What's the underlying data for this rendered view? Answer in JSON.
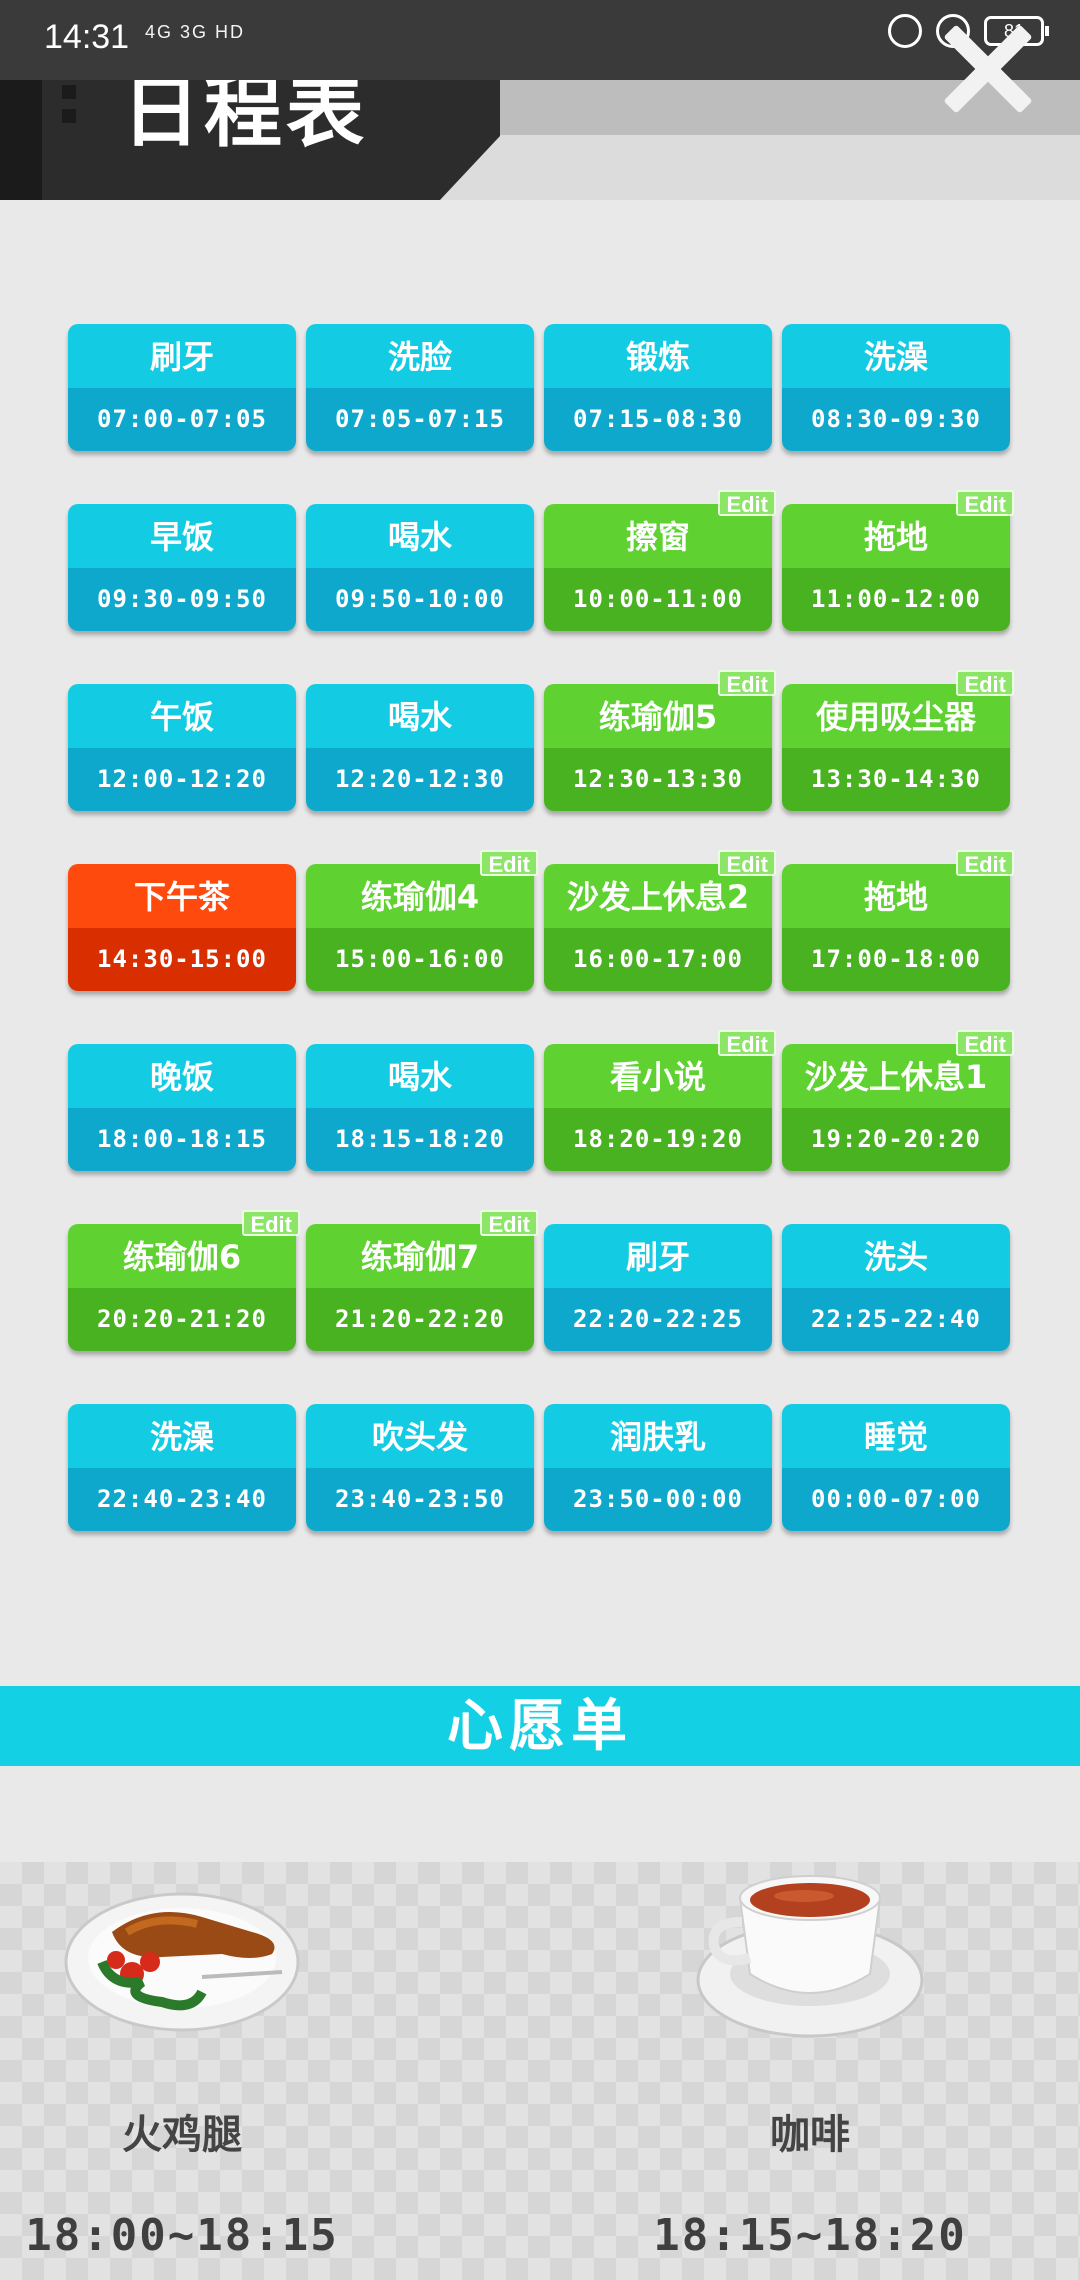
{
  "status_bar": {
    "time": "14:31",
    "network": "4G 3G HD",
    "battery": "81"
  },
  "header": {
    "title": "日程表",
    "close_icon": "close-icon"
  },
  "schedule": [
    {
      "name": "刷牙",
      "time": "07:00-07:05",
      "color": "blue",
      "edit": false
    },
    {
      "name": "洗脸",
      "time": "07:05-07:15",
      "color": "blue",
      "edit": false
    },
    {
      "name": "锻炼",
      "time": "07:15-08:30",
      "color": "blue",
      "edit": false
    },
    {
      "name": "洗澡",
      "time": "08:30-09:30",
      "color": "blue",
      "edit": false
    },
    {
      "name": "早饭",
      "time": "09:30-09:50",
      "color": "blue",
      "edit": false
    },
    {
      "name": "喝水",
      "time": "09:50-10:00",
      "color": "blue",
      "edit": false
    },
    {
      "name": "擦窗",
      "time": "10:00-11:00",
      "color": "green",
      "edit": true
    },
    {
      "name": "拖地",
      "time": "11:00-12:00",
      "color": "green",
      "edit": true
    },
    {
      "name": "午饭",
      "time": "12:00-12:20",
      "color": "blue",
      "edit": false
    },
    {
      "name": "喝水",
      "time": "12:20-12:30",
      "color": "blue",
      "edit": false
    },
    {
      "name": "练瑜伽5",
      "time": "12:30-13:30",
      "color": "green",
      "edit": true
    },
    {
      "name": "使用吸尘器",
      "time": "13:30-14:30",
      "color": "green",
      "edit": true
    },
    {
      "name": "下午茶",
      "time": "14:30-15:00",
      "color": "red",
      "edit": false
    },
    {
      "name": "练瑜伽4",
      "time": "15:00-16:00",
      "color": "green",
      "edit": true
    },
    {
      "name": "沙发上休息2",
      "time": "16:00-17:00",
      "color": "green",
      "edit": true
    },
    {
      "name": "拖地",
      "time": "17:00-18:00",
      "color": "green",
      "edit": true
    },
    {
      "name": "晚饭",
      "time": "18:00-18:15",
      "color": "blue",
      "edit": false
    },
    {
      "name": "喝水",
      "time": "18:15-18:20",
      "color": "blue",
      "edit": false
    },
    {
      "name": "看小说",
      "time": "18:20-19:20",
      "color": "green",
      "edit": true
    },
    {
      "name": "沙发上休息1",
      "time": "19:20-20:20",
      "color": "green",
      "edit": true
    },
    {
      "name": "练瑜伽6",
      "time": "20:20-21:20",
      "color": "green",
      "edit": true
    },
    {
      "name": "练瑜伽7",
      "time": "21:20-22:20",
      "color": "green",
      "edit": true
    },
    {
      "name": "刷牙",
      "time": "22:20-22:25",
      "color": "blue",
      "edit": false
    },
    {
      "name": "洗头",
      "time": "22:25-22:40",
      "color": "blue",
      "edit": false
    },
    {
      "name": "洗澡",
      "time": "22:40-23:40",
      "color": "blue",
      "edit": false
    },
    {
      "name": "吹头发",
      "time": "23:40-23:50",
      "color": "blue",
      "edit": false
    },
    {
      "name": "润肤乳",
      "time": "23:50-00:00",
      "color": "blue",
      "edit": false
    },
    {
      "name": "睡觉",
      "time": "00:00-07:00",
      "color": "blue",
      "edit": false
    }
  ],
  "edit_label": "Edit",
  "wishlist": {
    "title": "心愿单",
    "items": [
      {
        "name": "火鸡腿",
        "time": "18:00~18:15",
        "icon": "turkey-leg-icon"
      },
      {
        "name": "咖啡",
        "time": "18:15~18:20",
        "icon": "coffee-cup-icon"
      }
    ]
  },
  "colors": {
    "blue_top": "#13cbe2",
    "blue_bottom": "#0ea8cd",
    "green_top": "#5fd231",
    "green_bottom": "#48b221",
    "red_top": "#ff4a0d",
    "red_bottom": "#d82e00",
    "banner": "#14d0e4"
  }
}
